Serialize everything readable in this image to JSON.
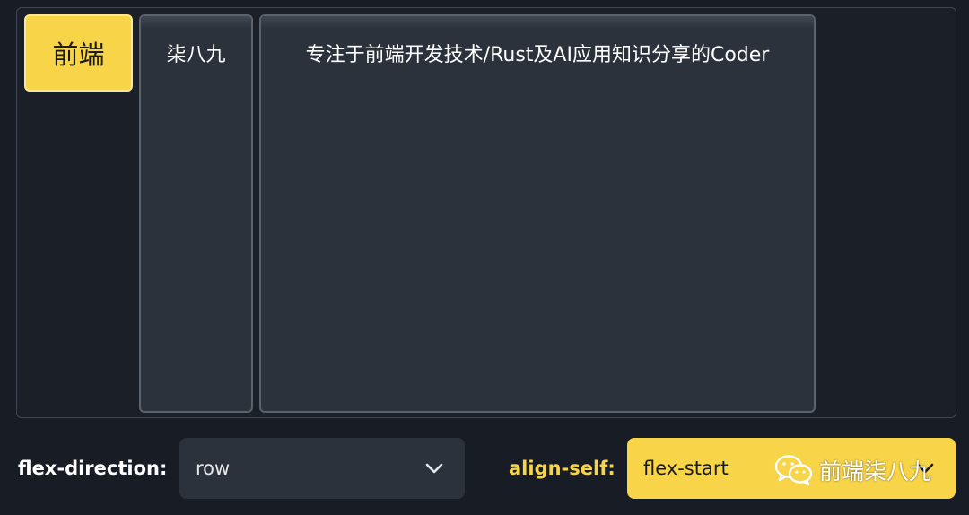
{
  "stage": {
    "items": [
      {
        "label": "前端"
      },
      {
        "label": "柒八九"
      },
      {
        "label": "专注于前端开发技术/Rust及AI应用知识分享的Coder"
      }
    ]
  },
  "controls": {
    "flex_direction": {
      "label": "flex-direction:",
      "value": "row"
    },
    "align_self": {
      "label": "align-self:",
      "value": "flex-start"
    }
  },
  "watermark": {
    "text": "前端柒八九"
  },
  "colors": {
    "accent": "#f8d548",
    "background": "#181d25",
    "item": "#2c323b",
    "border": "#5a626e"
  },
  "icons": {
    "select_chevron": "chevron-down-icon",
    "watermark_logo": "wechat-icon"
  }
}
